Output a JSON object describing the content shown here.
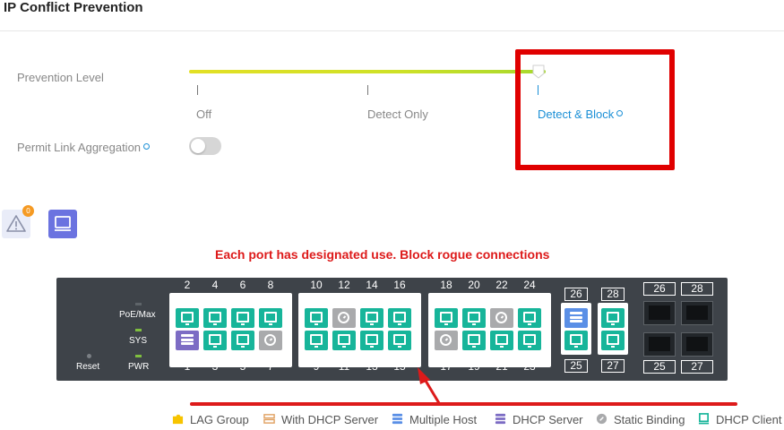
{
  "page": {
    "title": "IP Conflict Prevention"
  },
  "prevention": {
    "label": "Prevention Level",
    "levels": [
      "Off",
      "Detect Only",
      "Detect & Block"
    ],
    "selected": "Detect & Block"
  },
  "link_aggregation": {
    "label": "Permit Link Aggregation",
    "enabled": false
  },
  "alerts": {
    "count": "0"
  },
  "annotation": "Each port has designated use. Block rogue connections",
  "switch": {
    "status_labels": {
      "poe": "PoE/Max",
      "sys": "SYS",
      "pwr": "PWR",
      "reset": "Reset"
    },
    "groups": [
      {
        "top": [
          "2",
          "4",
          "6",
          "8"
        ],
        "bottom": [
          "1",
          "3",
          "5",
          "7"
        ],
        "top_types": [
          "client",
          "client",
          "client",
          "client"
        ],
        "bottom_types": [
          "dhcp",
          "client",
          "client",
          "static"
        ]
      },
      {
        "top": [
          "10",
          "12",
          "14",
          "16"
        ],
        "bottom": [
          "9",
          "11",
          "13",
          "15"
        ],
        "top_types": [
          "client",
          "static",
          "client",
          "client"
        ],
        "bottom_types": [
          "client",
          "client",
          "client",
          "client"
        ]
      },
      {
        "top": [
          "18",
          "20",
          "22",
          "24"
        ],
        "bottom": [
          "17",
          "19",
          "21",
          "23"
        ],
        "top_types": [
          "client",
          "client",
          "static",
          "client"
        ],
        "bottom_types": [
          "static",
          "client",
          "client",
          "client"
        ]
      }
    ],
    "combo_ports": [
      {
        "top": "26",
        "bottom": "25",
        "top_type": "multi",
        "bottom_type": "client"
      },
      {
        "top": "28",
        "bottom": "27",
        "top_type": "client",
        "bottom_type": "client"
      }
    ],
    "sfp_ports": {
      "top": [
        "26",
        "28"
      ],
      "bottom": [
        "25",
        "27"
      ]
    }
  },
  "legend": [
    "LAG Group",
    "With DHCP Server",
    "Multiple Host",
    "DHCP Server",
    "Static Binding",
    "DHCP Client"
  ],
  "colors": {
    "accent": "#1a8fd6",
    "client": "#17b59a",
    "static": "#a9aaac",
    "dhcp_server": "#7c6cc4",
    "multiple_host": "#5a8fe6",
    "lag": "#f7c400",
    "with_dhcp": "#e0a060",
    "highlight": "#e00000"
  }
}
